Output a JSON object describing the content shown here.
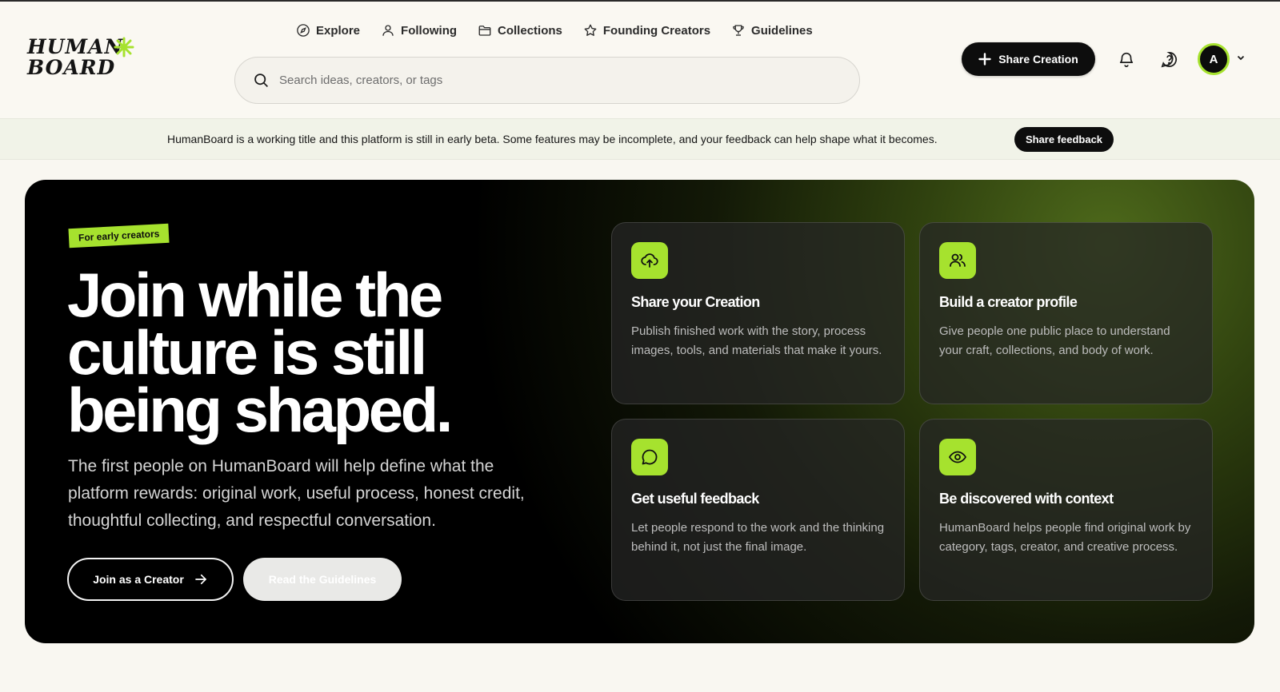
{
  "brand": {
    "logo_line1": "HUMAN",
    "logo_line2": "BOARD",
    "accent_color": "#a6e22e",
    "dark_color": "#0d0d0d"
  },
  "nav": {
    "items": [
      {
        "label": "Explore",
        "icon": "compass-icon"
      },
      {
        "label": "Following",
        "icon": "user-icon"
      },
      {
        "label": "Collections",
        "icon": "folder-icon"
      },
      {
        "label": "Founding Creators",
        "icon": "star-icon"
      },
      {
        "label": "Guidelines",
        "icon": "trophy-icon"
      }
    ]
  },
  "search": {
    "placeholder": "Search ideas, creators, or tags",
    "value": ""
  },
  "header_actions": {
    "share_label": "Share Creation",
    "notifications_icon": "bell-icon",
    "help_icon": "help-icon",
    "avatar_initial": "A"
  },
  "banner": {
    "text": "HumanBoard is a working title and this platform is still in early beta. Some features may be incomplete, and your feedback can help shape what it becomes.",
    "button_label": "Share feedback"
  },
  "hero": {
    "tag": "For early creators",
    "headline_line1": "Join while the",
    "headline_line2": "culture is still",
    "headline_line3": "being shaped.",
    "subtext": "The first people on HumanBoard will help define what the platform rewards: original work, useful process, honest credit, thoughtful collecting, and respectful conversation.",
    "primary_button": "Join as a Creator",
    "secondary_button": "Read the Guidelines"
  },
  "cards": [
    {
      "icon": "upload-cloud-icon",
      "title": "Share your Creation",
      "description": "Publish finished work with the story, process images, tools, and materials that make it yours."
    },
    {
      "icon": "users-icon",
      "title": "Build a creator profile",
      "description": "Give people one public place to understand your craft, collections, and body of work."
    },
    {
      "icon": "message-icon",
      "title": "Get useful feedback",
      "description": "Let people respond to the work and the thinking behind it, not just the final image."
    },
    {
      "icon": "eye-icon",
      "title": "Be discovered with context",
      "description": "HumanBoard helps people find original work by category, tags, creator, and creative process."
    }
  ]
}
